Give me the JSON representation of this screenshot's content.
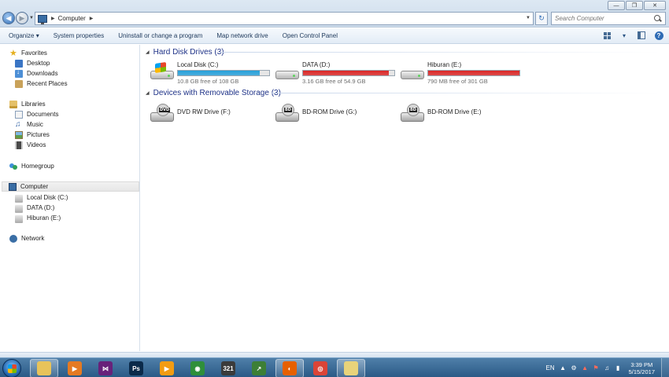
{
  "window": {
    "address_path": "Computer",
    "search_placeholder": "Search Computer"
  },
  "toolbar": {
    "organize": "Organize",
    "system_properties": "System properties",
    "uninstall": "Uninstall or change a program",
    "map_drive": "Map network drive",
    "control_panel": "Open Control Panel"
  },
  "nav": {
    "favorites": "Favorites",
    "desktop": "Desktop",
    "downloads": "Downloads",
    "recent_places": "Recent Places",
    "libraries": "Libraries",
    "documents": "Documents",
    "music": "Music",
    "pictures": "Pictures",
    "videos": "Videos",
    "homegroup": "Homegroup",
    "computer": "Computer",
    "drive_c": "Local Disk (C:)",
    "drive_d": "DATA (D:)",
    "drive_e": "Hiburan (E:)",
    "network": "Network"
  },
  "groups": {
    "hdd_title": "Hard Disk Drives (3)",
    "removable_title": "Devices with Removable Storage (3)"
  },
  "hard_drives": [
    {
      "name": "Local Disk (C:)",
      "free_text": "10.8 GB free of 108 GB",
      "used_fraction": 0.9,
      "bar_color": "#26a0da",
      "icon": "windows-drive-icon"
    },
    {
      "name": "DATA (D:)",
      "free_text": "3.16 GB free of 54.9 GB",
      "used_fraction": 0.94,
      "bar_color": "#da2626",
      "icon": "hard-drive-icon"
    },
    {
      "name": "Hiburan (E:)",
      "free_text": "790 MB free of 301 GB",
      "used_fraction": 0.997,
      "bar_color": "#da2626",
      "icon": "hard-drive-icon"
    }
  ],
  "removable_drives": [
    {
      "name": "DVD RW Drive (F:)",
      "label": "DVD",
      "icon": "dvd-drive-icon"
    },
    {
      "name": "BD-ROM Drive (G:)",
      "label": "BD",
      "icon": "bd-drive-icon"
    },
    {
      "name": "BD-ROM Drive (E:)",
      "label": "BD",
      "icon": "bd-drive-icon"
    }
  ],
  "taskbar": {
    "language": "EN",
    "time": "3:39 PM",
    "date": "5/15/2017",
    "apps": [
      {
        "icon": "explorer-icon",
        "glyph": "",
        "color": "#e8c35a",
        "active": true
      },
      {
        "icon": "media-player-icon",
        "glyph": "▶",
        "color": "#e57a22",
        "active": false
      },
      {
        "icon": "visual-studio-icon",
        "glyph": "⋈",
        "color": "#68217a",
        "active": false
      },
      {
        "icon": "photoshop-icon",
        "glyph": "Ps",
        "color": "#0b2a4a",
        "active": false
      },
      {
        "icon": "vlc-icon",
        "glyph": "▶",
        "color": "#f39c12",
        "active": false
      },
      {
        "icon": "globe-download-icon",
        "glyph": "◉",
        "color": "#2f8f3a",
        "active": false
      },
      {
        "icon": "clapper-icon",
        "glyph": "321",
        "color": "#3b3b3b",
        "active": false
      },
      {
        "icon": "chart-icon",
        "glyph": "↗",
        "color": "#3d7f36",
        "active": false
      },
      {
        "icon": "firefox-icon",
        "glyph": "◐",
        "color": "#e66000",
        "active": true
      },
      {
        "icon": "chrome-icon",
        "glyph": "◎",
        "color": "#db4437",
        "active": false
      },
      {
        "icon": "folders-icon",
        "glyph": "",
        "color": "#e8d37a",
        "active": true
      }
    ]
  }
}
